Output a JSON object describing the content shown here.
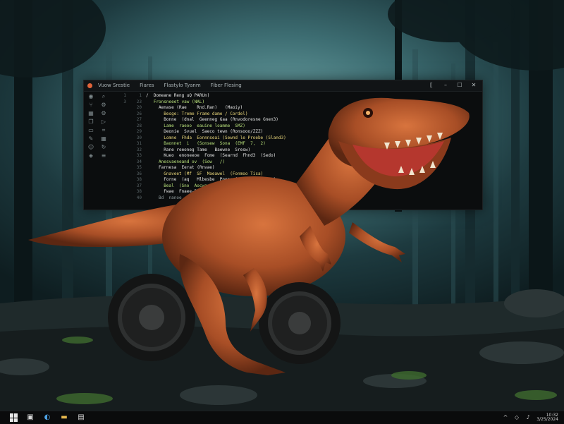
{
  "editor": {
    "menu": [
      "Vuow Srestie",
      "Fiares",
      "Flastylo Tyanm",
      "Fiber Flesing"
    ],
    "controls": [
      "restore-icon",
      "minimize-icon",
      "maximize-icon",
      "close-icon"
    ],
    "activity_icons": [
      "explorer-icon",
      "search-icon",
      "git-icon",
      "debug-icon",
      "extensions-icon",
      "settings-icon",
      "files-icon",
      "run-icon",
      "terminal-icon",
      "bookmark-icon",
      "outline-icon",
      "grid-icon",
      "account-icon",
      "sync-icon",
      "layers-icon",
      "menu-icon"
    ],
    "gutter_a": [
      "1",
      "3",
      "",
      "",
      "",
      "",
      "",
      "",
      "",
      "",
      "",
      "",
      "",
      "",
      "",
      "",
      "",
      ""
    ],
    "gutter_b": [
      "1",
      "23",
      "20",
      "26",
      "27",
      "28",
      "29",
      "30",
      "31",
      "32",
      "33",
      "34",
      "35",
      "36",
      "38",
      "37",
      "38",
      "40"
    ],
    "code_lines": [
      "/  Domeane Reng uQ PARUn)",
      "   Fronsneeet vaw (NAL)",
      "     Aenase (Rae    Rnd.Ran)   (Maoiy)",
      "       Besge: Treme Frame dame / Cordel)",
      "       Bonne  (dnal  Geenneg Gaa (Rnvodoresne Gnen3)",
      "       Lame  raeoo  eauine loamme  SMZ)",
      "       Deonie  Svuel  Saeco tewn (Ronsooo/ZZZ)",
      "       Lomne  Fhda  Eonnnseai (Sewnd le Proebe (Sland3)",
      "       Baonnet  i   (Sonsew  Sona  (EMF  7,  2)",
      "       Rane reeoneg Tame   Baewne  Sresw)",
      "       Kueo  enoneeoe  Fome  (Searnd  Fhnd3  (Sedo)",
      "     Anesvaeneand ov  (Sow   /)",
      "     Farnesa  Eerat (Rnvae)",
      "       Gnaveet (Mf  SF  Maeawel  (Fonmoo Tisa)",
      "       Forne  (aq   Mlbesbe  Poeoe (Aenoee Goane  )",
      "       Beal  (Sno  Aocwaonaeveriw  Rbwoanae  Bneb  )",
      "       Fwae  Fnaee-Rawabar.Raeaanae  Saa3)",
      "     Bd  nanoe  bane  Seaeenoe"
    ]
  },
  "taskbar": {
    "apps": [
      "file-explorer-icon",
      "browser-icon",
      "folder-icon",
      "photos-icon"
    ],
    "tray": [
      "chevron-up-icon",
      "network-icon",
      "volume-icon"
    ],
    "clock_time": "10:32",
    "clock_date": "3/25/2024"
  }
}
